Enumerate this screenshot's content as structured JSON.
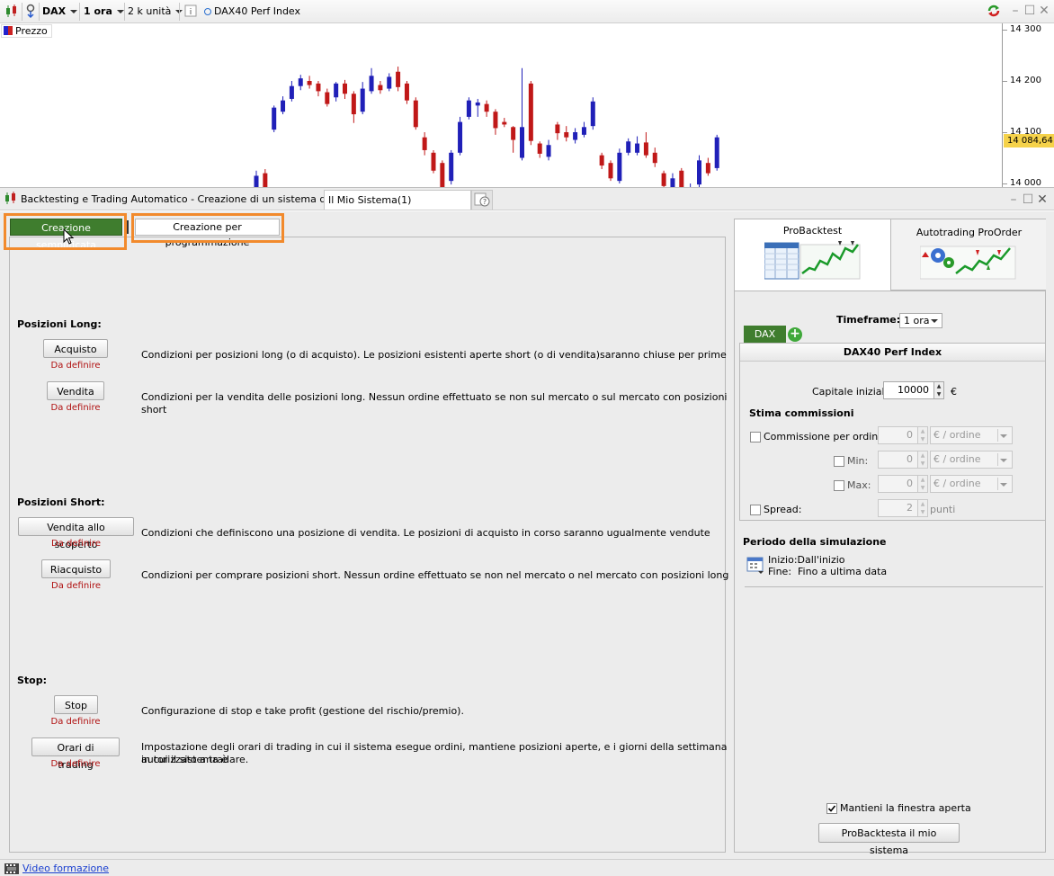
{
  "toolbar": {
    "symbol": "DAX",
    "timeframe": "1 ora",
    "units": "2 k unità",
    "instrument": "DAX40 Perf Index"
  },
  "chart": {
    "legend_label": "Prezzo",
    "y_ticks": [
      "14 300",
      "14 200",
      "14 100",
      "14 000"
    ],
    "last_price": "14 084,64"
  },
  "chart_data": {
    "type": "candlestick",
    "ylim": [
      13930,
      14320
    ],
    "colors": {
      "up": "#2020b8",
      "down": "#c01818"
    },
    "candles": [
      {
        "o": 13985,
        "c": 14015,
        "h": 14025,
        "l": 13975
      },
      {
        "o": 14020,
        "c": 13985,
        "h": 14028,
        "l": 13975
      },
      {
        "o": 14105,
        "c": 14148,
        "h": 14152,
        "l": 14100
      },
      {
        "o": 14140,
        "c": 14162,
        "h": 14170,
        "l": 14135
      },
      {
        "o": 14165,
        "c": 14190,
        "h": 14200,
        "l": 14160
      },
      {
        "o": 14190,
        "c": 14205,
        "h": 14212,
        "l": 14182
      },
      {
        "o": 14200,
        "c": 14192,
        "h": 14210,
        "l": 14185
      },
      {
        "o": 14195,
        "c": 14180,
        "h": 14200,
        "l": 14170
      },
      {
        "o": 14178,
        "c": 14155,
        "h": 14185,
        "l": 14150
      },
      {
        "o": 14168,
        "c": 14195,
        "h": 14198,
        "l": 14160
      },
      {
        "o": 14195,
        "c": 14175,
        "h": 14202,
        "l": 14165
      },
      {
        "o": 14175,
        "c": 14135,
        "h": 14180,
        "l": 14118
      },
      {
        "o": 14140,
        "c": 14185,
        "h": 14198,
        "l": 14135
      },
      {
        "o": 14180,
        "c": 14210,
        "h": 14225,
        "l": 14175
      },
      {
        "o": 14192,
        "c": 14182,
        "h": 14200,
        "l": 14175
      },
      {
        "o": 14185,
        "c": 14208,
        "h": 14215,
        "l": 14180
      },
      {
        "o": 14218,
        "c": 14188,
        "h": 14228,
        "l": 14180
      },
      {
        "o": 14195,
        "c": 14162,
        "h": 14200,
        "l": 14155
      },
      {
        "o": 14162,
        "c": 14110,
        "h": 14168,
        "l": 14105
      },
      {
        "o": 14090,
        "c": 14065,
        "h": 14100,
        "l": 14055
      },
      {
        "o": 14060,
        "c": 14025,
        "h": 14065,
        "l": 14020
      },
      {
        "o": 14040,
        "c": 13985,
        "h": 14045,
        "l": 13978
      },
      {
        "o": 14005,
        "c": 14060,
        "h": 14065,
        "l": 13998
      },
      {
        "o": 14060,
        "c": 14120,
        "h": 14130,
        "l": 14055
      },
      {
        "o": 14130,
        "c": 14162,
        "h": 14168,
        "l": 14125
      },
      {
        "o": 14152,
        "c": 14158,
        "h": 14165,
        "l": 14130
      },
      {
        "o": 14155,
        "c": 14140,
        "h": 14162,
        "l": 14130
      },
      {
        "o": 14140,
        "c": 14108,
        "h": 14145,
        "l": 14095
      },
      {
        "o": 14120,
        "c": 14115,
        "h": 14128,
        "l": 14110
      },
      {
        "o": 14110,
        "c": 14085,
        "h": 14112,
        "l": 14060
      },
      {
        "o": 14050,
        "c": 14110,
        "h": 14225,
        "l": 14045
      },
      {
        "o": 14195,
        "c": 14083,
        "h": 14200,
        "l": 14075
      },
      {
        "o": 14078,
        "c": 14058,
        "h": 14082,
        "l": 14050
      },
      {
        "o": 14052,
        "c": 14075,
        "h": 14085,
        "l": 14045
      },
      {
        "o": 14115,
        "c": 14098,
        "h": 14120,
        "l": 14085
      },
      {
        "o": 14100,
        "c": 14090,
        "h": 14112,
        "l": 14082
      },
      {
        "o": 14085,
        "c": 14100,
        "h": 14108,
        "l": 14078
      },
      {
        "o": 14095,
        "c": 14110,
        "h": 14120,
        "l": 14090
      },
      {
        "o": 14112,
        "c": 14160,
        "h": 14168,
        "l": 14105
      },
      {
        "o": 14055,
        "c": 14035,
        "h": 14060,
        "l": 14028
      },
      {
        "o": 14040,
        "c": 14010,
        "h": 14045,
        "l": 14005
      },
      {
        "o": 14005,
        "c": 14060,
        "h": 14068,
        "l": 14000
      },
      {
        "o": 14060,
        "c": 14082,
        "h": 14088,
        "l": 14055
      },
      {
        "o": 14060,
        "c": 14078,
        "h": 14092,
        "l": 14055
      },
      {
        "o": 14080,
        "c": 14055,
        "h": 14100,
        "l": 14050
      },
      {
        "o": 14060,
        "c": 14040,
        "h": 14070,
        "l": 14032
      },
      {
        "o": 14020,
        "c": 13995,
        "h": 14025,
        "l": 13985
      },
      {
        "o": 13990,
        "c": 14010,
        "h": 14020,
        "l": 13985
      },
      {
        "o": 14025,
        "c": 13965,
        "h": 14030,
        "l": 13960
      },
      {
        "o": 13970,
        "c": 13990,
        "h": 14000,
        "l": 13962
      },
      {
        "o": 13998,
        "c": 14045,
        "h": 14055,
        "l": 13990
      },
      {
        "o": 14040,
        "c": 14020,
        "h": 14050,
        "l": 14015
      },
      {
        "o": 14030,
        "c": 14090,
        "h": 14095,
        "l": 14025
      }
    ]
  },
  "panel": {
    "title": "Backtesting e Trading Automatico - Creazione di un sistema di trading",
    "tab_name": "Il Mio Sistema(1)"
  },
  "left": {
    "tab_simple": "Creazione semplificata",
    "tab_programming": "Creazione per programmazione",
    "undefined_label": "Da definire",
    "long": {
      "title": "Posizioni Long:",
      "buy_btn": "Acquisto",
      "buy_desc": "Condizioni per posizioni long (o di acquisto). Le posizioni esistenti aperte short (o di vendita)saranno chiuse per prime",
      "sell_btn": "Vendita",
      "sell_desc": "Condizioni per la vendita delle posizioni long. Nessun ordine effettuato se non sul mercato o sul mercato con posizioni short"
    },
    "short": {
      "title": "Posizioni Short:",
      "short_btn": "Vendita allo scoperto",
      "short_desc": "Condizioni che definiscono una posizione di vendita. Le posizioni di acquisto in corso saranno ugualmente vendute",
      "cover_btn": "Riacquisto",
      "cover_desc": "Condizioni per comprare posizioni short. Nessun ordine effettuato se non nel mercato o nel mercato con posizioni long"
    },
    "stop": {
      "title": "Stop:",
      "stop_btn": "Stop",
      "stop_desc": "Configurazione di stop e take profit (gestione del rischio/premio).",
      "hours_btn": "Orari di trading",
      "hours_desc_1": "Impostazione degli orari di trading in cui il sistema esegue ordini, mantiene posizioni aperte, e i giorni della settimana in cui il sistema è",
      "hours_desc_2": "autorizzato a tradare."
    }
  },
  "right": {
    "tab_backtest": "ProBacktest",
    "tab_autotrading": "Autotrading ProOrder",
    "timeframe_label": "Timeframe:",
    "timeframe_value": "1 ora",
    "instrument_tab": "DAX",
    "instrument_name": "DAX40 Perf Index",
    "capital_label": "Capitale iniziale :",
    "capital_value": "10000",
    "currency": "€",
    "commissions_title": "Stima commissioni",
    "commission_per_order": "Commissione per ordine :",
    "min_label": "Min:",
    "max_label": "Max:",
    "spread_label": "Spread:",
    "zero": "0",
    "spread_value": "2",
    "per_order_unit": "€ / ordine",
    "points": "punti",
    "period_title": "Periodo della simulazione",
    "start": "Inizio:Dall'inizio",
    "end": "Fine:  Fino a ultima data",
    "keep_open": "Mantieni la finestra aperta",
    "run_btn": "ProBacktesta il mio sistema"
  },
  "status": {
    "video_link": "Video formazione"
  }
}
